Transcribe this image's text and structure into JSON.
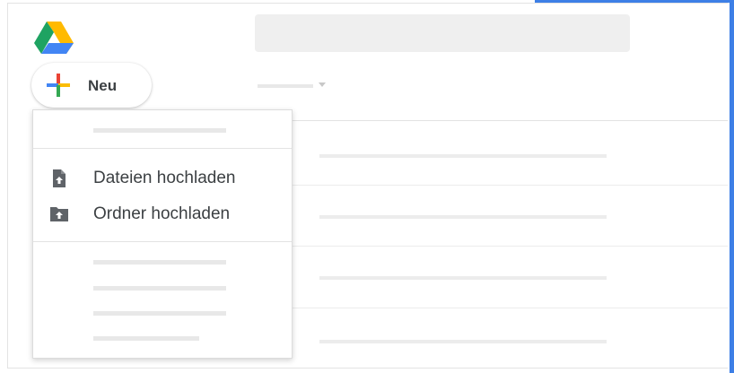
{
  "header": {
    "new_button_label": "Neu"
  },
  "new_menu": {
    "items": [
      {
        "label": "Dateien hochladen",
        "icon": "file-upload-icon"
      },
      {
        "label": "Ordner hochladen",
        "icon": "folder-upload-icon"
      }
    ]
  },
  "colors": {
    "highlight": "#3d7fe6",
    "drive_green": "#1ea362",
    "drive_yellow": "#ffba00",
    "drive_blue": "#4285f4",
    "plus_red": "#ea4335",
    "plus_blue": "#4285f4",
    "plus_yellow": "#fbbc04",
    "plus_green": "#34a853",
    "icon_grey": "#5f6368"
  }
}
